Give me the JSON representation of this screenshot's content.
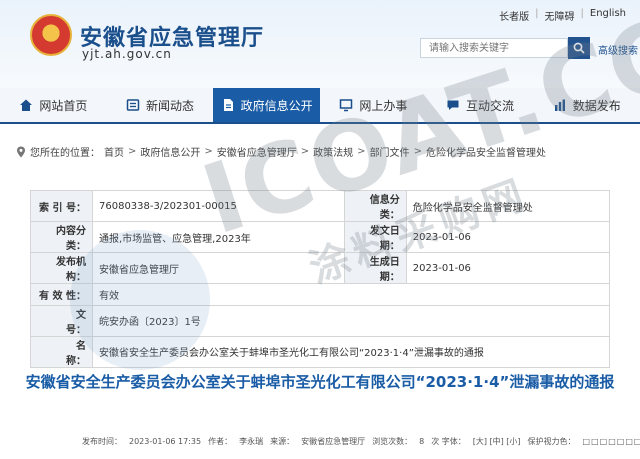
{
  "header": {
    "site_title": "安徽省应急管理厅",
    "site_domain": "yjt.ah.gov.cn",
    "top_links": [
      "长者版",
      "无障碍",
      "English"
    ],
    "search_placeholder": "请输入搜索关键字",
    "advanced_search": "高级搜索"
  },
  "nav": {
    "items": [
      {
        "label": "网站首页",
        "icon": "home-icon"
      },
      {
        "label": "新闻动态",
        "icon": "news-icon"
      },
      {
        "label": "政府信息公开",
        "icon": "document-icon",
        "active": true
      },
      {
        "label": "网上办事",
        "icon": "monitor-icon"
      },
      {
        "label": "互动交流",
        "icon": "chat-icon"
      },
      {
        "label": "数据发布",
        "icon": "chart-icon"
      }
    ]
  },
  "breadcrumb": {
    "prefix": "您所在的位置：",
    "items": [
      "首页",
      "政府信息公开",
      "安徽省应急管理厅",
      "政策法规",
      "部门文件",
      "危险化学品安全监督管理处"
    ]
  },
  "info": {
    "index_label": "索 引 号：",
    "index_value": "76080338-3/202301-00015",
    "info_source_label": "信息分类：",
    "info_source_value": "危险化学品安全监督管理处",
    "category_label": "内容分类：",
    "category_value": "通报,市场监管、应急管理,2023年",
    "date_label": "发文日期：",
    "date_value": "2023-01-06",
    "publisher_label": "发布机构：",
    "publisher_value": "安徽省应急管理厅",
    "created_label": "生成日期：",
    "created_value": "2023-01-06",
    "validity_label": "有 效 性：",
    "validity_value": "有效",
    "docno_label": "文　　号：",
    "docno_value": "皖安办函〔2023〕1号",
    "title_label": "名　　称：",
    "title_value": "安徽省安全生产委员会办公室关于蚌埠市圣光化工有限公司“2023·1·4”泄漏事故的通报"
  },
  "article": {
    "title": "安徽省安全生产委员会办公室关于蚌埠市圣光化工有限公司“2023·1·4”泄漏事故的通报",
    "meta_time_label": "发布时间：",
    "meta_time": "2023-01-06 17:35",
    "meta_author_label": "作者：",
    "meta_author": "李永瑞",
    "meta_source_label": "来源：",
    "meta_source": "安徽省应急管理厅",
    "meta_views_label": "浏览次数：",
    "meta_views": "8",
    "meta_font_label": "次 字体：",
    "meta_font_sizes": "[大] [中] [小]",
    "meta_eye_label": "保护视力色：",
    "meta_eye_boxes": "□□□□□□□□□"
  },
  "watermark": {
    "latin": "ICOAT.CC",
    "chinese": "涂料采购网"
  },
  "colors": {
    "brand_blue": "#1a4f8b",
    "nav_active": "#1a5ca6",
    "label_bg": "#eef2f6"
  }
}
